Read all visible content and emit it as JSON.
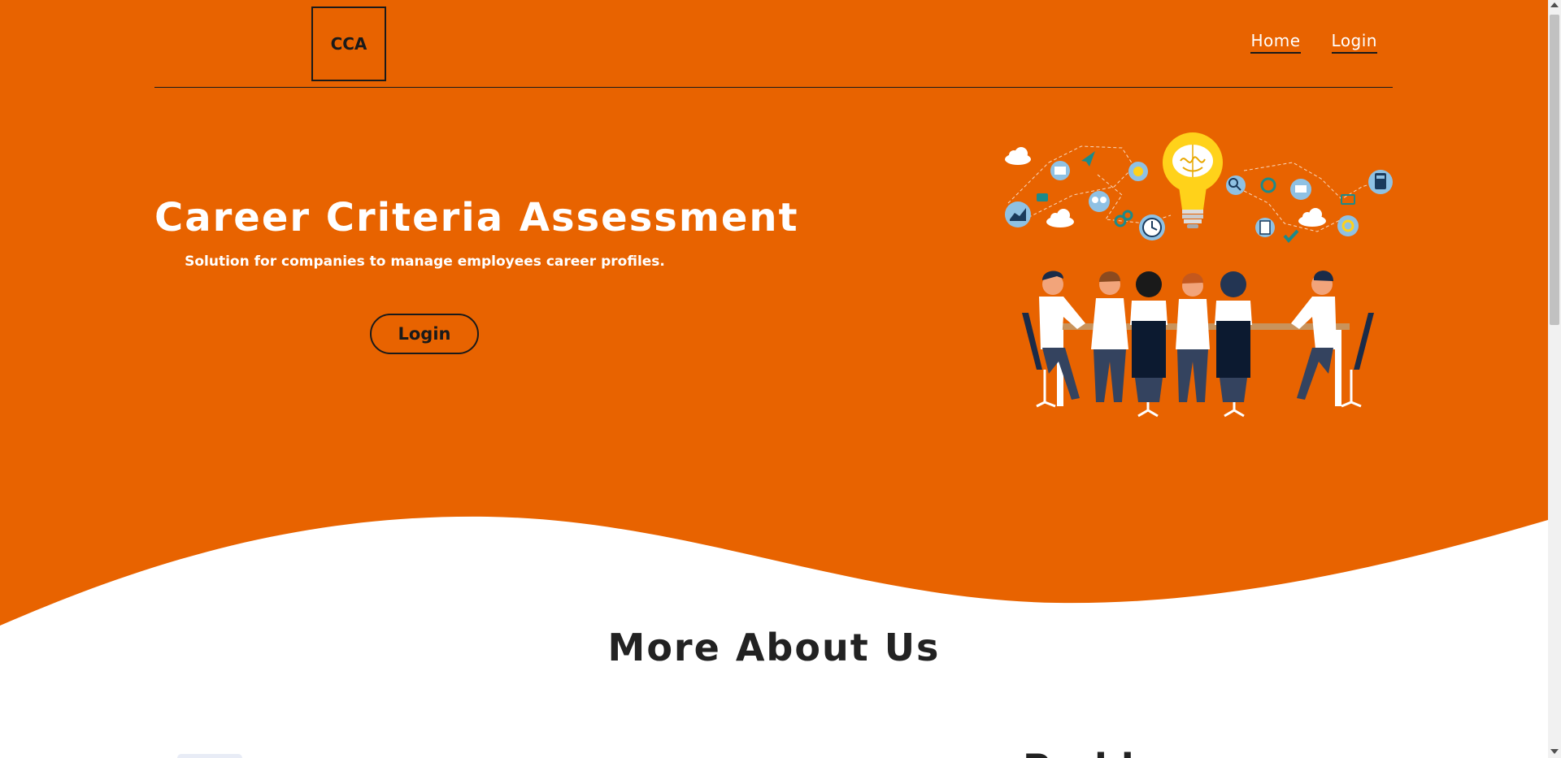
{
  "colors": {
    "hero_background": "#e86300",
    "text_dark": "#1a1a1a",
    "text_light": "#ffffff",
    "bulb": "#ffd21a"
  },
  "header": {
    "logo_text": "CCA",
    "nav": [
      {
        "label": "Home"
      },
      {
        "label": "Login"
      }
    ]
  },
  "hero": {
    "title": "Career Criteria Assessment",
    "subtitle": "Solution for companies to manage employees career profiles.",
    "login_button": "Login",
    "illustration": "team-meeting-idea-illustration"
  },
  "about": {
    "title": "More About Us",
    "partial_heading": "Problem"
  }
}
